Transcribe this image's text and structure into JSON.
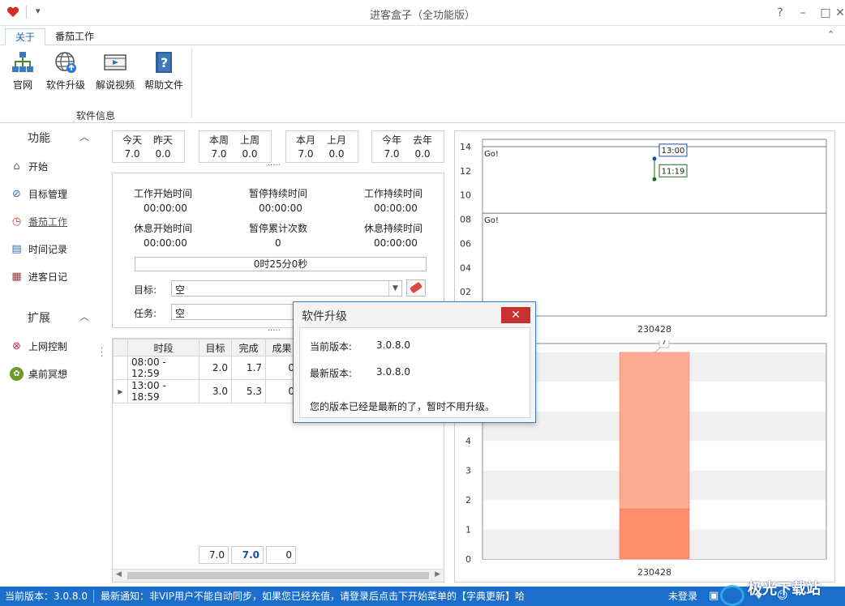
{
  "window": {
    "title": "进客盒子（全功能版）",
    "quick_access": "▾"
  },
  "ribbon": {
    "tabs": [
      {
        "label": "关于",
        "active": true
      },
      {
        "label": "番茄工作",
        "active": false
      }
    ],
    "buttons": [
      {
        "label": "官网",
        "icon": "org-chart-icon"
      },
      {
        "label": "软件升级",
        "icon": "globe-upgrade-icon"
      },
      {
        "label": "解说视频",
        "icon": "video-film-icon"
      },
      {
        "label": "帮助文件",
        "icon": "help-book-icon"
      }
    ],
    "group_label": "软件信息"
  },
  "sidebar": {
    "function_title": "功能",
    "function_items": [
      {
        "label": "开始",
        "icon": "home-icon"
      },
      {
        "label": "目标管理",
        "icon": "compass-icon"
      },
      {
        "label": "番茄工作",
        "icon": "clock-icon",
        "active": true
      },
      {
        "label": "时间记录",
        "icon": "notebook-icon"
      },
      {
        "label": "进客日记",
        "icon": "calendar-icon"
      }
    ],
    "extend_title": "扩展",
    "extend_items": [
      {
        "label": "上网控制",
        "icon": "eye-slash-icon"
      },
      {
        "label": "桌前冥想",
        "icon": "lotus-icon"
      }
    ]
  },
  "stats": [
    {
      "a_label": "今天",
      "a_value": "7.0",
      "b_label": "昨天",
      "b_value": "0.0"
    },
    {
      "a_label": "本周",
      "a_value": "7.0",
      "b_label": "上周",
      "b_value": "0.0"
    },
    {
      "a_label": "本月",
      "a_value": "7.0",
      "b_label": "上月",
      "b_value": "0.0"
    },
    {
      "a_label": "今年",
      "a_value": "7.0",
      "b_label": "去年",
      "b_value": "0.0"
    }
  ],
  "timers": {
    "work_start_label": "工作开始时间",
    "work_start_value": "00:00:00",
    "pause_duration_label": "暂停持续时间",
    "pause_duration_value": "00:00:00",
    "work_duration_label": "工作持续时间",
    "work_duration_value": "00:00:00",
    "rest_start_label": "休息开始时间",
    "rest_start_value": "00:00:00",
    "pause_count_label": "暂停累计次数",
    "pause_count_value": "0",
    "rest_duration_label": "休息持续时间",
    "rest_duration_value": "00:00:00",
    "progress_text": "0时25分0秒",
    "goal_label": "目标:",
    "goal_value": "空",
    "task_label": "任务:",
    "task_value": "空"
  },
  "table": {
    "headers": [
      "时段",
      "目标",
      "完成",
      "成果"
    ],
    "rows": [
      {
        "period": "08:00 - 12:59",
        "target": "2.0",
        "done": "1.7",
        "result": "0"
      },
      {
        "period": "13:00 - 18:59",
        "target": "3.0",
        "done": "5.3",
        "result": "0"
      }
    ],
    "totals": [
      "7.0",
      "7.0",
      "0"
    ]
  },
  "splitter_dots": "·····",
  "chart_data": [
    {
      "type": "line",
      "x_categories": [
        "230428"
      ],
      "y_ticks": [
        "02",
        "04",
        "06",
        "08",
        "10",
        "12",
        "14"
      ],
      "ylim": [
        0,
        14.6
      ],
      "annotations": [
        {
          "label": "Go!",
          "y": 14.0
        },
        {
          "label": "Go!",
          "y": 8.5
        }
      ],
      "points": [
        {
          "label": "13:00",
          "y": 13.0
        },
        {
          "label": "11:19",
          "y": 11.3
        }
      ]
    },
    {
      "type": "bar",
      "categories": [
        "230428"
      ],
      "y_ticks": [
        "0",
        "1",
        "2",
        "3",
        "4"
      ],
      "ylim": [
        0,
        7.3
      ],
      "series": [
        {
          "values": [
            1.7
          ],
          "color": "#ff8c6a"
        },
        {
          "values": [
            5.3
          ],
          "color": "#ffab92"
        }
      ],
      "total_label": "7"
    }
  ],
  "dialog": {
    "title": "软件升级",
    "current_label": "当前版本:",
    "current_value": "3.0.8.0",
    "latest_label": "最新版本:",
    "latest_value": "3.0.8.0",
    "message": "您的版本已经是最新的了，暂时不用升级。"
  },
  "status": {
    "version": "当前版本：3.0.8.0",
    "notice": "最新通知：非VIP用户不能自动同步，如果您已经充值，请登录后点击下开始菜单的【字典更新】哈",
    "login": "未登录",
    "watermark": "极光下载站"
  },
  "colors": {
    "accent": "#1b6fcb",
    "dialog_close": "#c8312f",
    "bar_dark": "#ff8c6a",
    "bar_light": "#ffab92"
  }
}
